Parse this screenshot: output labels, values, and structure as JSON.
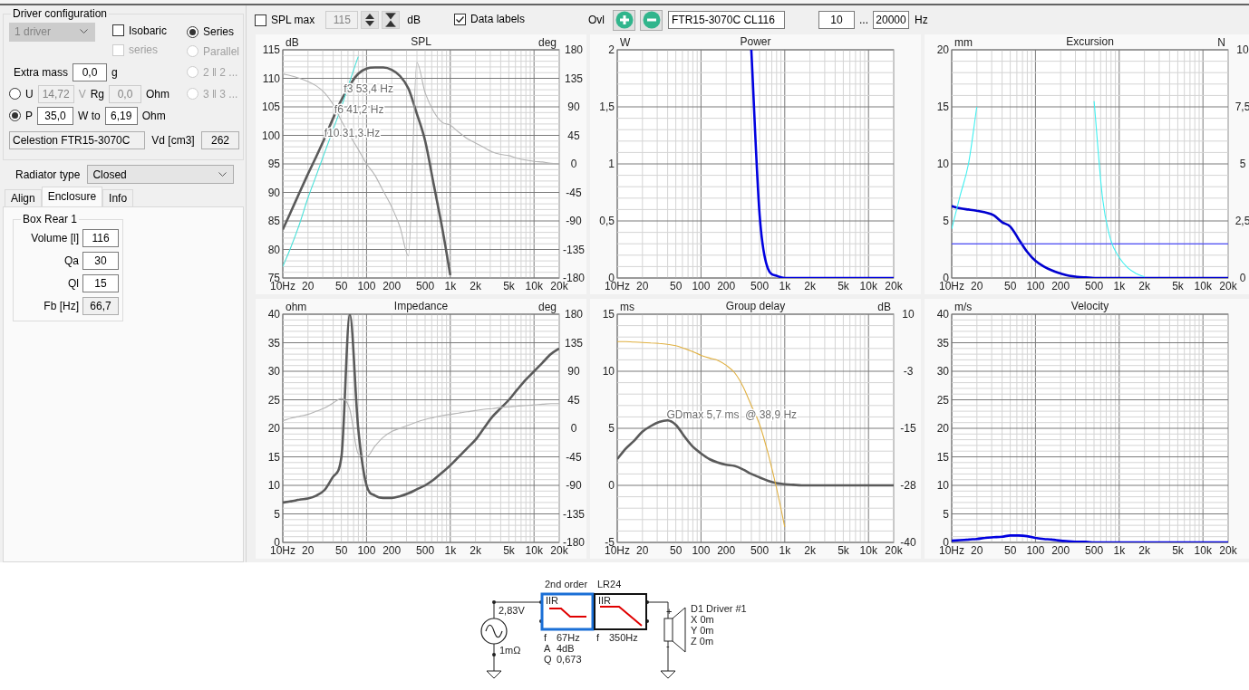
{
  "driver_configuration": {
    "title": "Driver configuration",
    "driver_count": {
      "value": "1 driver",
      "disabled": true
    },
    "isobaric": {
      "label": "Isobaric",
      "checked": false,
      "disabled": false
    },
    "isobaric_series": {
      "label": "series",
      "checked": false,
      "disabled": true
    },
    "wiring": [
      {
        "label": "Series",
        "selected": true,
        "disabled": false
      },
      {
        "label": "Parallel",
        "selected": false,
        "disabled": true
      },
      {
        "label": "2 ‖ 2 ...",
        "selected": false,
        "disabled": true
      },
      {
        "label": "3 ‖ 3 ...",
        "selected": false,
        "disabled": true
      }
    ],
    "extra_mass": {
      "label": "Extra mass",
      "value": "0,0",
      "unit": "g"
    },
    "drive": [
      {
        "label": "U",
        "selected": false,
        "value": "14,72",
        "unit": "V",
        "disabled": true,
        "second": {
          "label": "Rg",
          "value": "0,0",
          "unit": "Ohm",
          "disabled": true
        }
      },
      {
        "label": "P",
        "selected": true,
        "value": "35,0",
        "unit": "W to",
        "disabled": false,
        "second": {
          "value": "6,19",
          "unit": "Ohm",
          "disabled": false
        }
      }
    ],
    "driver_name": "Celestion FTR15-3070C",
    "vd": {
      "label": "Vd [cm3]",
      "value": "262"
    }
  },
  "radiator_type": {
    "label": "Radiator type",
    "value": "Closed"
  },
  "tabs": [
    {
      "label": "Align",
      "selected": false
    },
    {
      "label": "Enclosure",
      "selected": true
    },
    {
      "label": "Info",
      "selected": false
    }
  ],
  "box": {
    "title": "Box Rear 1",
    "fields": [
      {
        "label": "Volume [l]",
        "value": "116",
        "readonly": false
      },
      {
        "label": "Qa",
        "value": "30",
        "readonly": false
      },
      {
        "label": "Ql",
        "value": "15",
        "readonly": false
      },
      {
        "label": "Fb [Hz]",
        "value": "66,7",
        "readonly": true
      }
    ]
  },
  "toolbar": {
    "spl_max": {
      "label": "SPL max",
      "checked": false,
      "value": "115",
      "unit": "dB"
    },
    "data_labels": {
      "label": "Data labels",
      "checked": true
    },
    "overlay": {
      "label": "Ovl",
      "name": "FTR15-3070C CL116"
    },
    "frequency_range": {
      "from": "10",
      "separator": "...",
      "to": "20000",
      "unit": "Hz"
    }
  },
  "charts": [
    {
      "chart_data": {
        "type": "line",
        "grid": true,
        "title": "SPL",
        "ylabel": "dB",
        "y2label": "deg",
        "categories": [
          "10Hz",
          null,
          null,
          "20",
          null,
          null,
          null,
          "50",
          null,
          null,
          "100",
          null,
          null,
          "200",
          null,
          null,
          null,
          "500",
          null,
          null,
          "1k",
          null,
          null,
          "2k",
          null,
          null,
          null,
          "5k",
          null,
          null,
          "10k",
          null,
          null,
          "20k"
        ],
        "ylim": [
          75,
          115
        ],
        "yticks": [
          75,
          80,
          85,
          90,
          95,
          100,
          105,
          110,
          115
        ],
        "y2lim": [
          -180,
          180
        ],
        "y2ticks": [
          -180,
          -135,
          -90,
          -45,
          0,
          45,
          90,
          135,
          180
        ],
        "series": [
          {
            "color": "#5a5a5a",
            "values": [
              83.5,
              86.7,
              90,
              93.2,
              96.3,
              99.5,
              103,
              106.2,
              108.8,
              110.8,
              111.7,
              111.9,
              111.9,
              111.5,
              110.4,
              108.2,
              103.8,
              99,
              91.5,
              84,
              75.5,
              null,
              null,
              null,
              null,
              null,
              null,
              null,
              null,
              null,
              null,
              null,
              null,
              null
            ]
          },
          {
            "color": "#48e0d8",
            "values": [
              77,
              80.5,
              84.5,
              89,
              93,
              97,
              101,
              105,
              109.5,
              113.8,
              null,
              null,
              null,
              null,
              null,
              null,
              null,
              null,
              null,
              null,
              null,
              null,
              null,
              null,
              null,
              null,
              null,
              null,
              null,
              null,
              null,
              null,
              null,
              null
            ]
          },
          {
            "color": "#b4b4b4",
            "axis": "y2",
            "values": [
              142,
              139,
              135,
              130,
              123,
              112,
              94,
              68,
              45,
              23,
              0,
              -18,
              -43,
              -68,
              -100,
              -145,
              160,
              112,
              83,
              66,
              61,
              50,
              40,
              33,
              26,
              19,
              15,
              13,
              9,
              6,
              4,
              3,
              1,
              0
            ]
          }
        ],
        "annotations": [
          "f3 53,4 Hz",
          "f6 41,2 Hz",
          "f10 31,3 Hz"
        ]
      }
    },
    {
      "chart_data": {
        "type": "line",
        "grid": true,
        "title": "Power",
        "ylabel": "W",
        "categories": [
          "10Hz",
          null,
          null,
          "20",
          null,
          null,
          null,
          "50",
          null,
          null,
          "100",
          null,
          null,
          "200",
          null,
          null,
          null,
          "500",
          null,
          null,
          "1k",
          null,
          null,
          "2k",
          null,
          null,
          null,
          "5k",
          null,
          null,
          "10k",
          null,
          null,
          "20k"
        ],
        "ylim": [
          0,
          2
        ],
        "yticks": [
          0,
          {
            "value": 0.5,
            "label": "0,5"
          },
          1,
          {
            "value": 1.5,
            "label": "1,5"
          },
          2
        ],
        "series": [
          {
            "color": "#0000e0",
            "values": [
              null,
              null,
              null,
              null,
              null,
              null,
              null,
              null,
              null,
              null,
              null,
              null,
              null,
              null,
              null,
              null,
              2,
              0.55,
              0.08,
              0.02,
              0,
              0,
              0,
              0,
              0,
              0,
              0,
              0,
              0,
              0,
              0,
              0,
              0,
              0
            ]
          }
        ]
      }
    },
    {
      "chart_data": {
        "type": "line",
        "grid": true,
        "title": "Excursion",
        "ylabel": "mm",
        "y2label": "N",
        "categories": [
          "10Hz",
          null,
          null,
          "20",
          null,
          null,
          null,
          "50",
          null,
          null,
          "100",
          null,
          null,
          "200",
          null,
          null,
          null,
          "500",
          null,
          null,
          "1k",
          null,
          null,
          "2k",
          null,
          null,
          null,
          "5k",
          null,
          null,
          "10k",
          null,
          null,
          "20k"
        ],
        "ylim": [
          0,
          20
        ],
        "yticks": [
          0,
          5,
          10,
          15,
          20
        ],
        "y2lim": [
          0,
          10
        ],
        "y2ticks": [
          0,
          {
            "value": 2.5,
            "label": "2,5"
          },
          5,
          {
            "value": 7.5,
            "label": "7,5"
          },
          10
        ],
        "series": [
          {
            "color": "#0000d0",
            "values": [
              6.3,
              6.1,
              6,
              5.9,
              5.75,
              5.5,
              4.9,
              4.5,
              3.4,
              2.3,
              1.5,
              1,
              0.65,
              0.4,
              0.2,
              0.1,
              0.05,
              0,
              0,
              0,
              0,
              0,
              0,
              0,
              0,
              0,
              0,
              0,
              0,
              0,
              0,
              0,
              0,
              0
            ]
          },
          {
            "color": "#2828ff",
            "values": [
              3,
              3,
              3,
              3,
              3,
              3,
              3,
              3,
              3,
              3,
              3,
              3,
              3,
              3,
              3,
              3,
              3,
              3,
              3,
              3,
              3,
              3,
              3,
              3,
              3,
              3,
              3,
              3,
              3,
              3,
              3,
              3,
              3,
              3
            ]
          },
          {
            "color": "#40f0f0",
            "values": [
              4.3,
              7.2,
              10,
              15,
              null,
              null,
              null,
              null,
              null,
              null,
              null,
              null,
              null,
              null,
              null,
              null,
              null,
              15.5,
              7,
              3.3,
              1.8,
              0.9,
              0.4,
              0.1,
              null,
              null,
              null,
              null,
              null,
              null,
              null,
              null,
              null,
              null
            ]
          }
        ]
      }
    },
    {
      "chart_data": {
        "type": "line",
        "grid": true,
        "title": "Impedance",
        "ylabel": "ohm",
        "y2label": "deg",
        "categories": [
          "10Hz",
          null,
          null,
          "20",
          null,
          null,
          null,
          "50",
          null,
          null,
          "100",
          null,
          null,
          "200",
          null,
          null,
          null,
          "500",
          null,
          null,
          "1k",
          null,
          null,
          "2k",
          null,
          null,
          null,
          "5k",
          null,
          null,
          "10k",
          null,
          null,
          "20k"
        ],
        "ylim": [
          0,
          40
        ],
        "yticks": [
          0,
          5,
          10,
          15,
          20,
          25,
          30,
          35,
          40
        ],
        "y2lim": [
          -180,
          180
        ],
        "y2ticks": [
          -180,
          -135,
          -90,
          -45,
          0,
          45,
          90,
          135,
          180
        ],
        "series": [
          {
            "color": "#5a5a5a",
            "values": [
              7,
              7.2,
              7.5,
              7.7,
              8.2,
              9.2,
              11.5,
              15,
              40,
              20,
              10,
              8.2,
              7.8,
              7.8,
              8.1,
              8.6,
              9.3,
              10,
              11,
              12.2,
              13.5,
              15,
              16.5,
              18,
              20,
              22,
              23.5,
              25,
              26.8,
              28.5,
              30,
              31.5,
              33,
              34
            ]
          },
          {
            "color": "#b4b4b4",
            "axis": "y2",
            "values": [
              12,
              16,
              19,
              22,
              27,
              32,
              40,
              47,
              30,
              -40,
              -45,
              -28,
              -14,
              -5,
              0,
              5,
              10,
              14,
              17,
              20,
              22,
              24,
              26,
              28,
              30,
              31,
              33,
              34,
              35,
              36,
              37,
              38,
              39,
              39
            ]
          }
        ]
      }
    },
    {
      "chart_data": {
        "type": "line",
        "grid": true,
        "title": "Group delay",
        "ylabel": "ms",
        "y2label": "dB",
        "categories": [
          "10Hz",
          null,
          null,
          "20",
          null,
          null,
          null,
          "50",
          null,
          null,
          "100",
          null,
          null,
          "200",
          null,
          null,
          null,
          "500",
          null,
          null,
          "1k",
          null,
          null,
          "2k",
          null,
          null,
          null,
          "5k",
          null,
          null,
          "10k",
          null,
          null,
          "20k"
        ],
        "ylim": [
          -5,
          15
        ],
        "yticks": [
          -5,
          0,
          5,
          10,
          15
        ],
        "y2lim": [
          -40,
          10
        ],
        "y2ticks": [
          -40,
          {
            "value": -27.5,
            "label": "-28"
          },
          -15,
          {
            "value": -2.5,
            "label": "-3"
          },
          10
        ],
        "series": [
          {
            "color": "#5a5a5a",
            "values": [
              2.3,
              3.2,
              3.9,
              4.7,
              5.2,
              5.55,
              5.7,
              5.3,
              4.3,
              3.4,
              2.8,
              2.3,
              2,
              1.8,
              1.7,
              1.4,
              1,
              0.7,
              0.4,
              0.2,
              0.1,
              0.05,
              0,
              0,
              0,
              0,
              0,
              0,
              0,
              0,
              0,
              0,
              0,
              0
            ]
          },
          {
            "color": "#e0b040",
            "axis": "y2",
            "values": [
              4,
              4,
              3.9,
              3.8,
              3.7,
              3.6,
              3.4,
              3.1,
              2.5,
              1.8,
              1,
              0.4,
              -0.1,
              -1.2,
              -2.8,
              -5.8,
              -10,
              -14.2,
              -20.5,
              -28,
              -36.6,
              null,
              null,
              null,
              null,
              null,
              null,
              null,
              null,
              null,
              null,
              null,
              null,
              null
            ]
          }
        ],
        "annotations": [
          "GDmax 5,7 ms  @ 38,9 Hz"
        ]
      }
    },
    {
      "chart_data": {
        "type": "line",
        "grid": true,
        "title": "Velocity",
        "ylabel": "m/s",
        "categories": [
          "10Hz",
          null,
          null,
          "20",
          null,
          null,
          null,
          "50",
          null,
          null,
          "100",
          null,
          null,
          "200",
          null,
          null,
          null,
          "500",
          null,
          null,
          "1k",
          null,
          null,
          "2k",
          null,
          null,
          null,
          "5k",
          null,
          null,
          "10k",
          null,
          null,
          "20k"
        ],
        "ylim": [
          0,
          40
        ],
        "yticks": [
          0,
          5,
          10,
          15,
          20,
          25,
          30,
          35,
          40
        ],
        "series": [
          {
            "color": "#0000e0",
            "values": [
              0.3,
              0.4,
              0.5,
              0.6,
              0.8,
              0.9,
              1,
              1.2,
              1.2,
              1.1,
              0.8,
              0.6,
              0.5,
              0.3,
              0.2,
              0.1,
              0.1,
              0,
              0,
              0,
              0,
              0,
              0,
              0,
              0,
              0,
              0,
              0,
              0,
              0,
              0,
              0,
              0,
              0
            ]
          }
        ]
      }
    }
  ],
  "schematic": {
    "source": {
      "voltage": "2,83V",
      "resistance": "1mΩ"
    },
    "filters": [
      {
        "title": "2nd order",
        "type": "IIR",
        "kind": "shelf",
        "selected": true,
        "params": [
          {
            "name": "f",
            "value": "67Hz"
          },
          {
            "name": "A",
            "value": "4dB"
          },
          {
            "name": "Q",
            "value": "0,673"
          }
        ]
      },
      {
        "title": "LR24",
        "type": "IIR",
        "kind": "lowpass",
        "selected": false,
        "params": [
          {
            "name": "f",
            "value": "350Hz"
          }
        ]
      }
    ],
    "driver": {
      "name": "D1 Driver #1",
      "position": [
        "X 0m",
        "Y 0m",
        "Z 0m"
      ],
      "plus": "+",
      "minus": "-"
    }
  }
}
